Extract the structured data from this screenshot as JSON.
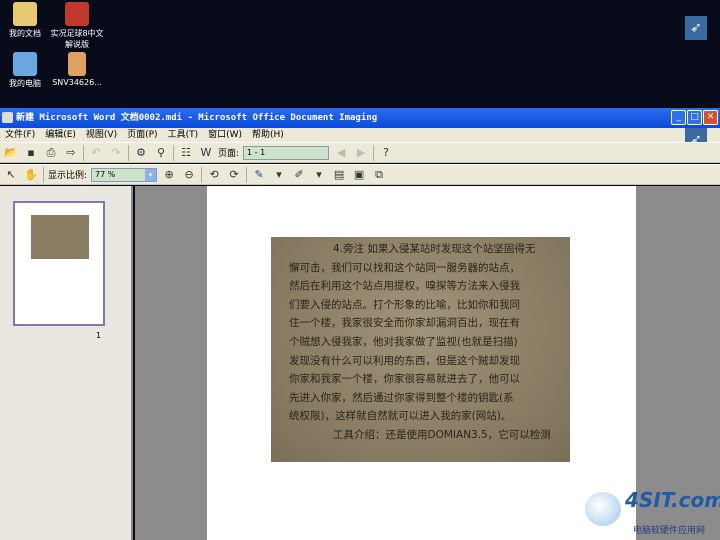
{
  "desktop": {
    "icons": [
      {
        "label": "我的文档"
      },
      {
        "label": "实况足球8中文解说版"
      },
      {
        "label": "我的电脑"
      },
      {
        "label": "SNV34626..."
      }
    ]
  },
  "window": {
    "title": "新建 Microsoft Word 文档0002.mdi - Microsoft Office Document Imaging",
    "min": "_",
    "max": "□",
    "close": "✕"
  },
  "menu": [
    "文件(F)",
    "编辑(E)",
    "视图(V)",
    "页面(P)",
    "工具(T)",
    "窗口(W)",
    "帮助(H)"
  ],
  "toolbar": {
    "page_label": "页面:",
    "page_value": "1 - 1",
    "zoom_label": "显示比例:",
    "zoom_value": "77 %"
  },
  "thumbnail": {
    "page_number": "1"
  },
  "document": {
    "lines": [
      "4.旁注 如果入侵某站时发现这个站坚固得无",
      "懈可击，我们可以找和这个站同一服务器的站点，",
      "然后在利用这个站点用提权，嗅探等方法来入侵我",
      "们要入侵的站点。打个形象的比喻，比如你和我同",
      "住一个楼，我家很安全而你家却漏洞百出，现在有",
      "个贼想入侵我家，他对我家做了监视(也就是扫描)",
      "发现没有什么可以利用的东西，但是这个贼却发现",
      "你家和我家一个楼，你家很容易就进去了，他可以",
      "先进入你家，然后通过你家得到整个楼的钥匙(系",
      "统权限)，这样就自然就可以进入我的家(网站)。",
      "工具介绍：还是使用DOMIAN3.5，它可以检测"
    ]
  },
  "watermark": {
    "brand": "4SIT.com",
    "tagline": "电脑软硬件应用网"
  }
}
